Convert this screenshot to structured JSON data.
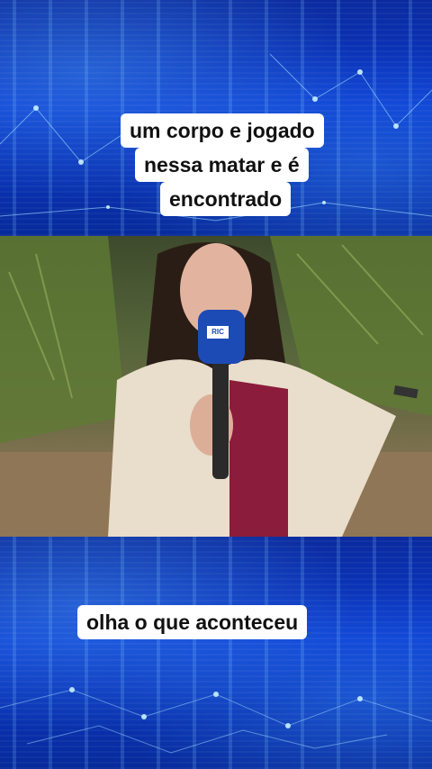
{
  "captions": {
    "top": [
      "um corpo e jogado",
      "nessa matar e é",
      "encontrado"
    ],
    "bottom": "olha o que aconteceu"
  },
  "microphone": {
    "label": "RIC"
  },
  "colors": {
    "band": "#0b3bd0",
    "caption_bg": "#ffffff",
    "caption_text": "#111111"
  }
}
